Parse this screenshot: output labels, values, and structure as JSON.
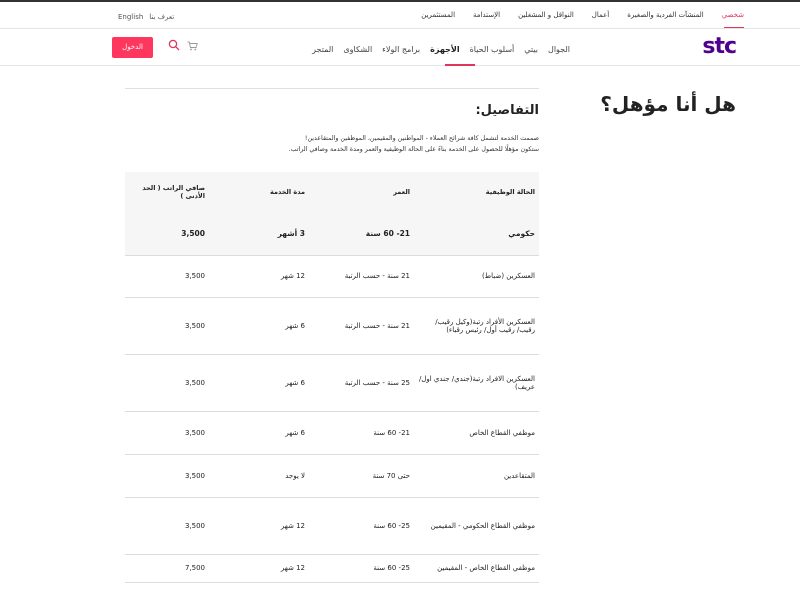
{
  "topbar": {
    "links": [
      "شخصي",
      "المنشآت الفردية والصغيرة",
      "أعمال",
      "النواقل و المشغلين",
      "الإستدامة",
      "المستثمرين"
    ],
    "language": "English",
    "contact": "تعرف بنا"
  },
  "navbar": {
    "logo": "stc",
    "menu": [
      "الجوال",
      "بيتي",
      "أسلوب الحياة",
      "الأجهزة",
      "برامج الولاء",
      "الشكاوى",
      "المتجر"
    ],
    "login_label": "الدخول",
    "icons": {
      "search": "search-icon",
      "cart": "cart-icon"
    },
    "accent_color": "#ff375e",
    "brand_color": "#4f008c"
  },
  "page": {
    "heading": "هل أنا مؤهل؟",
    "details_title": "التفاصيل:",
    "description": [
      "صممت الخدمة لتشمل كافة شرائح العملاء - المواطنين والمقيمين، الموظفين والمتقاعدين!",
      "ستكون مؤهلًا للحصول على الخدمة بناءً على الحالة الوظيفية والعمر ومدة الخدمة وصافي الراتب."
    ]
  },
  "table": {
    "headers": [
      "الحالة الوظيفية",
      "العمر",
      "مدة الخدمة",
      "صافي الراتب ( الحد الأدنى )"
    ],
    "rows": [
      [
        "حكومي",
        "21- 60 سنة",
        "3 أشهر",
        "3,500"
      ],
      [
        "العسكرين (ضباط)",
        "21 سنة - حسب الرتبة",
        "12 شهر",
        "3,500"
      ],
      [
        "العسكرين الأفراد رتبة(وكيل رقيب/ رقيب/ رقيب أول/ رئيس رقباء)",
        "21 سنة - حسب الرتبة",
        "6 شهر",
        "3,500"
      ],
      [
        "العسكرين الافراد رتبة(جندي/ جندي اول/ عريف)",
        "25 سنة - حسب الرتبة",
        "6 شهر",
        "3,500"
      ],
      [
        "موظفي القطاع الخاص",
        "21- 60 سنة",
        "6 شهر",
        "3,500"
      ],
      [
        "المتقاعدين",
        "حتى 70 سنة",
        "لا يوجد",
        "3,500"
      ],
      [
        "موظفي القطاع الحكومي - المقيمين",
        "25- 60 سنة",
        "12 شهر",
        "3,500"
      ],
      [
        "موظفي القطاع الخاص - المقيمين",
        "25- 60 سنة",
        "12 شهر",
        "7,500"
      ]
    ]
  }
}
